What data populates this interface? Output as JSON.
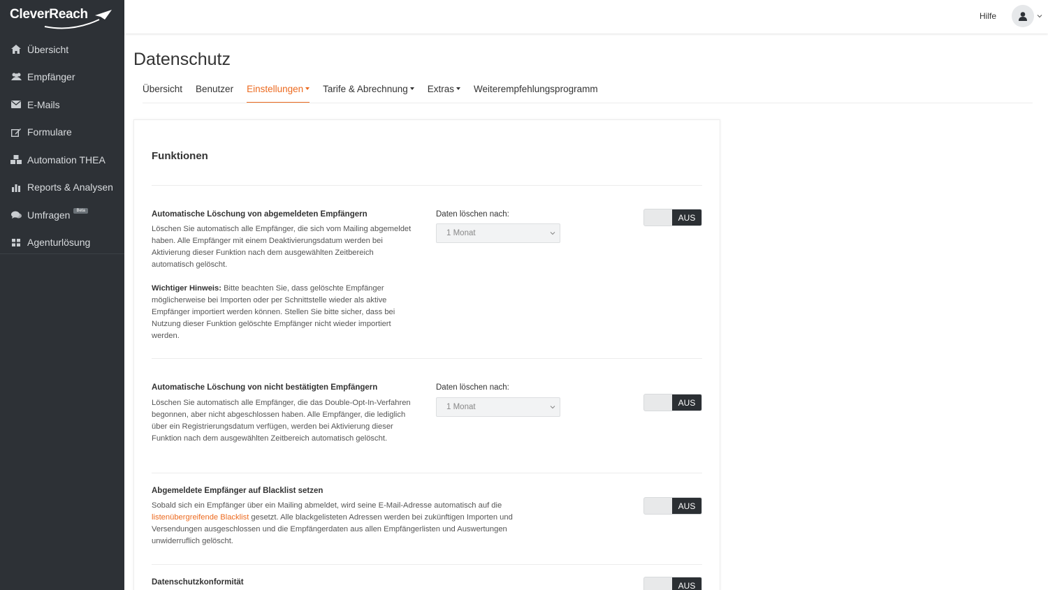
{
  "app": {
    "brand": "CleverReach",
    "brand_mark": "®"
  },
  "sidebar": {
    "items": [
      {
        "label": "Übersicht",
        "icon": "home-icon"
      },
      {
        "label": "Empfänger",
        "icon": "users-icon"
      },
      {
        "label": "E-Mails",
        "icon": "envelope-icon"
      },
      {
        "label": "Formulare",
        "icon": "edit-icon"
      },
      {
        "label": "Automation THEA",
        "icon": "cubes-icon"
      },
      {
        "label": "Reports & Analysen",
        "icon": "bar-chart-icon"
      },
      {
        "label": "Umfragen",
        "icon": "comments-icon",
        "badge": "Beta"
      },
      {
        "label": "Agenturlösung",
        "icon": "grid-icon"
      }
    ]
  },
  "topbar": {
    "help_label": "Hilfe",
    "avatar_icon": "user-icon"
  },
  "page": {
    "title": "Datenschutz",
    "tabs": [
      {
        "label": "Übersicht",
        "active": false,
        "dropdown": false
      },
      {
        "label": "Benutzer",
        "active": false,
        "dropdown": false
      },
      {
        "label": "Einstellungen",
        "active": true,
        "dropdown": true
      },
      {
        "label": "Tarife & Abrechnung",
        "active": false,
        "dropdown": true
      },
      {
        "label": "Extras",
        "active": false,
        "dropdown": true
      },
      {
        "label": "Weiterempfehlungsprogramm",
        "active": false,
        "dropdown": false
      }
    ]
  },
  "card": {
    "title": "Funktionen",
    "sections": [
      {
        "title": "Automatische Löschung von abgemeldeten Empfängern",
        "description": "Löschen Sie automatisch alle Empfänger, die sich vom Mailing abgemeldet haben. Alle Empfänger mit einem Deaktivierungsdatum werden bei Aktivierung dieser Funktion nach dem ausgewählten Zeitbereich automatisch gelöscht.",
        "note_label": "Wichtiger Hinweis:",
        "note_text": " Bitte beachten Sie, dass gelöschte Empfänger möglicherweise bei Importen oder per Schnittstelle wieder als aktive Empfänger importiert werden können. Stellen Sie bitte sicher, dass bei Nutzung dieser Funktion gelöschte Empfänger nicht wieder importiert werden.",
        "select_label": "Daten löschen nach:",
        "select_value": "1 Monat",
        "toggle_label": "AUS"
      },
      {
        "title": "Automatische Löschung von nicht bestätigten Empfängern",
        "description": "Löschen Sie automatisch alle Empfänger, die das Double-Opt-In-Verfahren begonnen, aber nicht abgeschlossen haben. Alle Empfänger, die lediglich über ein Registrierungsdatum verfügen, werden bei Aktivierung dieser Funktion nach dem ausgewählten Zeitbereich automatisch gelöscht.",
        "select_label": "Daten löschen nach:",
        "select_value": "1 Monat",
        "toggle_label": "AUS"
      },
      {
        "title": "Abgemeldete Empfänger auf Blacklist setzen",
        "description_before": "Sobald sich ein Empfänger über ein Mailing abmeldet, wird seine E-Mail-Adresse automatisch auf die ",
        "link_text": "listenübergreifende Blacklist",
        "description_after": " gesetzt. Alle blackgelisteten Adressen werden bei zukünftigen Importen und Versendungen ausgeschlossen und die Empfängerdaten aus allen Empfängerlisten und Auswertungen unwiderruflich gelöscht.",
        "toggle_label": "AUS"
      },
      {
        "title": "Datenschutzkonformität",
        "toggle_label": "AUS"
      }
    ]
  }
}
